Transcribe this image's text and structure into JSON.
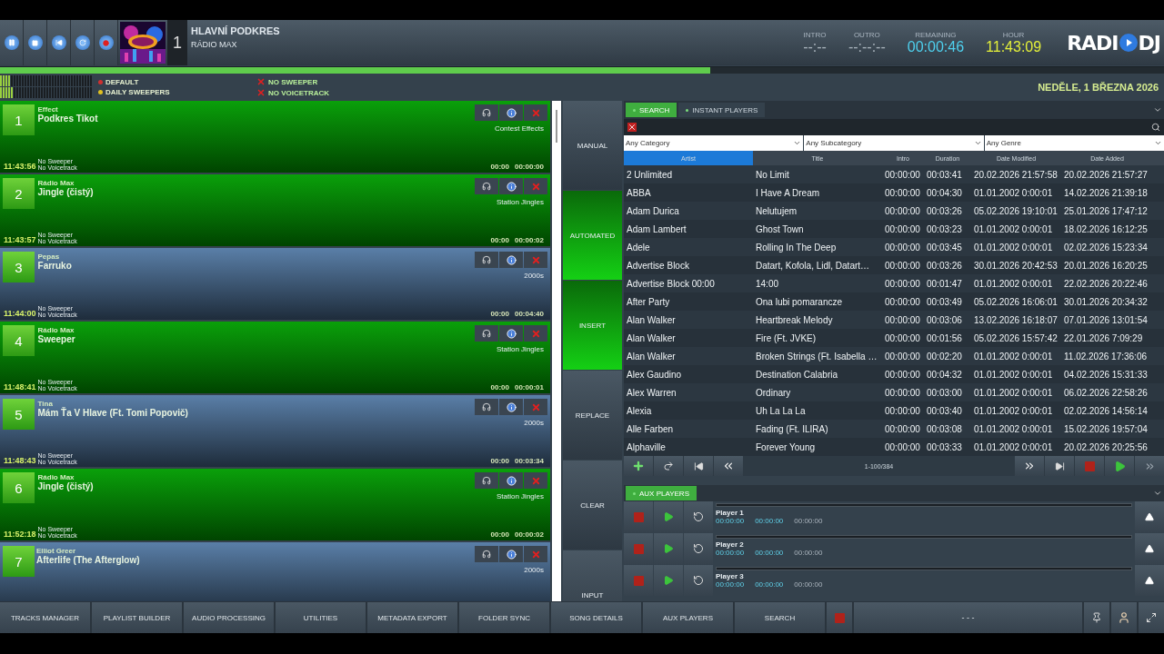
{
  "transport": {
    "buttons": [
      {
        "kind": "pause"
      },
      {
        "kind": "stop"
      },
      {
        "kind": "previous"
      },
      {
        "kind": "repeat"
      },
      {
        "kind": "record"
      }
    ]
  },
  "now_playing": {
    "deck": "1",
    "title": "HLAVNÍ PODKRES",
    "subtitle": "RÁDIO MAX"
  },
  "counters": [
    {
      "label": "INTRO",
      "value": "--:--",
      "kind": "idle"
    },
    {
      "label": "OUTRO",
      "value": "--:--:--",
      "kind": "idle"
    },
    {
      "label": "REMAINING",
      "value": "00:00:46",
      "kind": "remaining"
    },
    {
      "label": "HOUR",
      "value": "11:43:09",
      "kind": "clock"
    }
  ],
  "brand": {
    "left": "RADI",
    "right": "DJ"
  },
  "progress": {
    "level": 0.61
  },
  "rotations": [
    {
      "label": "DEFAULT",
      "color": "#d03030"
    },
    {
      "label": "DAILY SWEEPERS",
      "color": "#e0c020"
    }
  ],
  "flags": [
    {
      "label": "NO SWEEPER"
    },
    {
      "label": "NO VOICETRACK"
    }
  ],
  "date": "NEDĚLE, 1 BŘEZNA 2026",
  "playlist": [
    {
      "number": "1",
      "kind": "jingle",
      "artist": "Effect",
      "title": "Podkres Tikot",
      "category": "Contest Effects",
      "time": "11:43:56",
      "sweeper": "No Sweeper",
      "voicetrack": "No Voicetrack",
      "intro": "00:00",
      "duration": "00:00:00"
    },
    {
      "number": "2",
      "kind": "jingle",
      "artist": "Rádio Max",
      "title": "Jingle (čistý)",
      "category": "Station Jingles",
      "time": "11:43:57",
      "sweeper": "No Sweeper",
      "voicetrack": "No Voicetrack",
      "intro": "00:00",
      "duration": "00:00:02"
    },
    {
      "number": "3",
      "kind": "song",
      "artist": "Pepas",
      "title": "Farruko",
      "category": "2000s",
      "time": "11:44:00",
      "sweeper": "No Sweeper",
      "voicetrack": "No Voicetrack",
      "intro": "00:00",
      "duration": "00:04:40"
    },
    {
      "number": "4",
      "kind": "jingle",
      "artist": "Rádio Max",
      "title": "Sweeper",
      "category": "Station Jingles",
      "time": "11:48:41",
      "sweeper": "No Sweeper",
      "voicetrack": "No Voicetrack",
      "intro": "00:00",
      "duration": "00:00:01"
    },
    {
      "number": "5",
      "kind": "song",
      "artist": "Tina",
      "title": "Mám Ťa V Hlave (Ft. Tomi Popovič)",
      "category": "2000s",
      "time": "11:48:43",
      "sweeper": "No Sweeper",
      "voicetrack": "No Voicetrack",
      "intro": "00:00",
      "duration": "00:03:34"
    },
    {
      "number": "6",
      "kind": "jingle",
      "artist": "Rádio Max",
      "title": "Jingle (čistý)",
      "category": "Station Jingles",
      "time": "11:52:18",
      "sweeper": "No Sweeper",
      "voicetrack": "No Voicetrack",
      "intro": "00:00",
      "duration": "00:00:02"
    },
    {
      "number": "7",
      "kind": "song",
      "artist": "Elliot Greer",
      "title": "Afterlife (The Afterglow)",
      "category": "2000s"
    }
  ],
  "modes": [
    {
      "label": "MANUAL",
      "selected": false
    },
    {
      "label": "AUTOMATED",
      "selected": true
    },
    {
      "label": "INSERT",
      "selected": true
    },
    {
      "label": "REPLACE",
      "selected": false
    },
    {
      "label": "CLEAR",
      "selected": false
    },
    {
      "label": "INPUT",
      "selected": false
    }
  ],
  "tabs": [
    {
      "label": "SEARCH",
      "selected": true
    },
    {
      "label": "INSTANT PLAYERS",
      "selected": false
    }
  ],
  "filters": [
    {
      "value": "Any Category"
    },
    {
      "value": "Any Subcategory"
    },
    {
      "value": "Any Genre"
    }
  ],
  "table": {
    "columns": [
      {
        "label": "Artist",
        "sorted": true
      },
      {
        "label": "Title",
        "sorted": false
      },
      {
        "label": "Intro",
        "sorted": false
      },
      {
        "label": "Duration",
        "sorted": false
      },
      {
        "label": "Date Modified",
        "sorted": false
      },
      {
        "label": "Date Added",
        "sorted": false
      }
    ],
    "rows": [
      [
        "2 Unlimited",
        "No Limit",
        "00:00:00",
        "00:03:41",
        "20.02.2026 21:57:58",
        "20.02.2026 21:57:27"
      ],
      [
        "ABBA",
        "I Have A Dream",
        "00:00:00",
        "00:04:30",
        "01.01.2002 0:00:01",
        "14.02.2026 21:39:18"
      ],
      [
        "Adam Durica",
        "Nelutujem",
        "00:00:00",
        "00:03:26",
        "05.02.2026 19:10:01",
        "25.01.2026 17:47:12"
      ],
      [
        "Adam Lambert",
        "Ghost Town",
        "00:00:00",
        "00:03:23",
        "01.01.2002 0:00:01",
        "18.02.2026 16:12:25"
      ],
      [
        "Adele",
        "Rolling In The Deep",
        "00:00:00",
        "00:03:45",
        "01.01.2002 0:00:01",
        "02.02.2026 15:23:34"
      ],
      [
        "Advertise Block",
        "Datart, Kofola, Lidl, Datart…",
        "00:00:00",
        "00:03:26",
        "30.01.2026 20:42:53",
        "20.01.2026 16:20:25"
      ],
      [
        "Advertise Block 00:00",
        "14:00",
        "00:00:00",
        "00:01:47",
        "01.01.2002 0:00:01",
        "22.02.2026 20:22:46"
      ],
      [
        "After Party",
        "Ona lubi pomarancze",
        "00:00:00",
        "00:03:49",
        "05.02.2026 16:06:01",
        "30.01.2026 20:34:32"
      ],
      [
        "Alan Walker",
        "Heartbreak Melody",
        "00:00:00",
        "00:03:06",
        "13.02.2026 16:18:07",
        "07.01.2026 13:01:54"
      ],
      [
        "Alan Walker",
        "Fire (Ft. JVKE)",
        "00:00:00",
        "00:01:56",
        "05.02.2026 15:57:42",
        "22.01.2026 7:09:29"
      ],
      [
        "Alan Walker",
        "Broken Strings (Ft. Isabella …",
        "00:00:00",
        "00:02:20",
        "01.01.2002 0:00:01",
        "11.02.2026 17:36:06"
      ],
      [
        "Alex Gaudino",
        "Destination Calabria",
        "00:00:00",
        "00:04:32",
        "01.01.2002 0:00:01",
        "04.02.2026 15:31:33"
      ],
      [
        "Alex Warren",
        "Ordinary",
        "00:00:00",
        "00:03:00",
        "01.01.2002 0:00:01",
        "06.02.2026 22:58:26"
      ],
      [
        "Alexia",
        "Uh La La La",
        "00:00:00",
        "00:03:40",
        "01.01.2002 0:00:01",
        "02.02.2026 14:56:14"
      ],
      [
        "Alle Farben",
        "Fading (Ft. ILIRA)",
        "00:00:00",
        "00:03:08",
        "01.01.2002 0:00:01",
        "15.02.2026 19:57:04"
      ],
      [
        "Alphaville",
        "Forever Young",
        "00:00:00",
        "00:03:33",
        "01.01.2002 0:00:01",
        "20.02.2026 20:25:56"
      ]
    ]
  },
  "pager": {
    "left": [
      {
        "kind": "add"
      },
      {
        "kind": "redo"
      },
      {
        "kind": "first"
      },
      {
        "kind": "back"
      }
    ],
    "text": "1-100/384",
    "right": [
      {
        "kind": "forward"
      },
      {
        "kind": "last"
      },
      {
        "kind": "stop"
      },
      {
        "kind": "play"
      },
      {
        "kind": "next"
      }
    ]
  },
  "aux": {
    "tab": "AUX PLAYERS",
    "players": [
      {
        "name": "Player 1",
        "times": [
          "00:00:00",
          "00:00:00",
          "00:00:00"
        ]
      },
      {
        "name": "Player 2",
        "times": [
          "00:00:00",
          "00:00:00",
          "00:00:00"
        ]
      },
      {
        "name": "Player 3",
        "times": [
          "00:00:00",
          "00:00:00",
          "00:00:00"
        ]
      }
    ]
  },
  "bottom_bar": {
    "buttons": [
      "TRACKS MANAGER",
      "PLAYLIST BUILDER",
      "AUDIO PROCESSING",
      "UTILITIES",
      "METADATA EXPORT",
      "FOLDER SYNC",
      "SONG DETAILS",
      "AUX PLAYERS",
      "SEARCH"
    ],
    "status": "- - -"
  }
}
